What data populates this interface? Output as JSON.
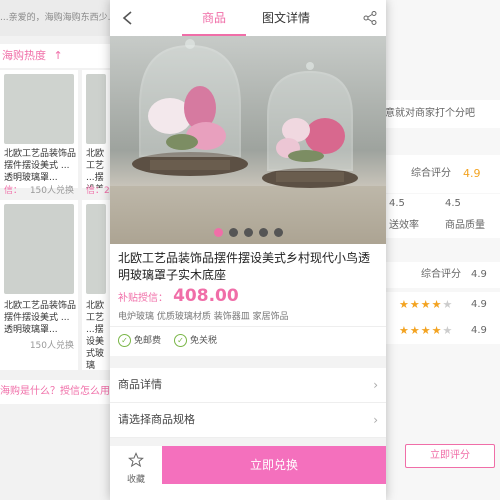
{
  "colors": {
    "accent": "#f06ea8",
    "cta": "#f470bd",
    "check": "#7ab648",
    "star": "#f3a321"
  },
  "left_screen": {
    "top_text": "...亲爱的，海购海购东西少...",
    "section_title": "海购热度",
    "cards": [
      {
        "title": "北欧工艺品装饰品摆件摆设美式 ...透明玻璃罩...",
        "price": "",
        "count": ""
      },
      {
        "title": "北欧工艺 ...摆设美式玻璃罩...",
        "price": "",
        "count": ""
      },
      {
        "title": "北欧工艺品装饰品摆件摆设美式 ...透明玻璃罩...",
        "price": "信：",
        "count": "150人兑换"
      },
      {
        "title": "北欧工艺 ...摆设美式玻璃罩...",
        "price": "信：2",
        "count": ""
      },
      {
        "title": "北欧工艺品装饰品摆件摆设美式 ...透明玻璃罩...",
        "price": "",
        "count": "150人兑换"
      },
      {
        "title": "北欧工艺 ...摆设美式玻璃罩...",
        "price": "",
        "count": ""
      }
    ],
    "bottom_text": "海购是什么？授信怎么用"
  },
  "right_screen": {
    "prompt": "意就对商家打个分吧",
    "overall_label": "综合评分",
    "overall_score": "4.9",
    "sub_scores": [
      {
        "value": "4.5",
        "label": "送效率"
      },
      {
        "value": "4.5",
        "label": "商品质量"
      }
    ],
    "overall2_label": "综合评分",
    "overall2_score": "4.9",
    "star_rows": [
      {
        "stars": 4,
        "score": "4.9"
      },
      {
        "stars": 4,
        "score": "4.9"
      }
    ],
    "rate_button": "立即评分"
  },
  "phone": {
    "tabs": [
      "商品",
      "图文详情"
    ],
    "active_tab": 0,
    "carousel": {
      "count": 5,
      "active": 0
    },
    "product_title": "北欧工艺品装饰品摆件摆设美式乡村现代小鸟透明玻璃罩子实木底座",
    "price_label": "补贴授信：",
    "price": "408.00",
    "tags": "电炉玻璃 优质玻璃材质 装饰器皿 家居饰品",
    "services": [
      "免邮费",
      "免关税"
    ],
    "rows": [
      "商品详情",
      "请选择商品规格"
    ],
    "fav_label": "收藏",
    "cta_label": "立即兑换"
  }
}
